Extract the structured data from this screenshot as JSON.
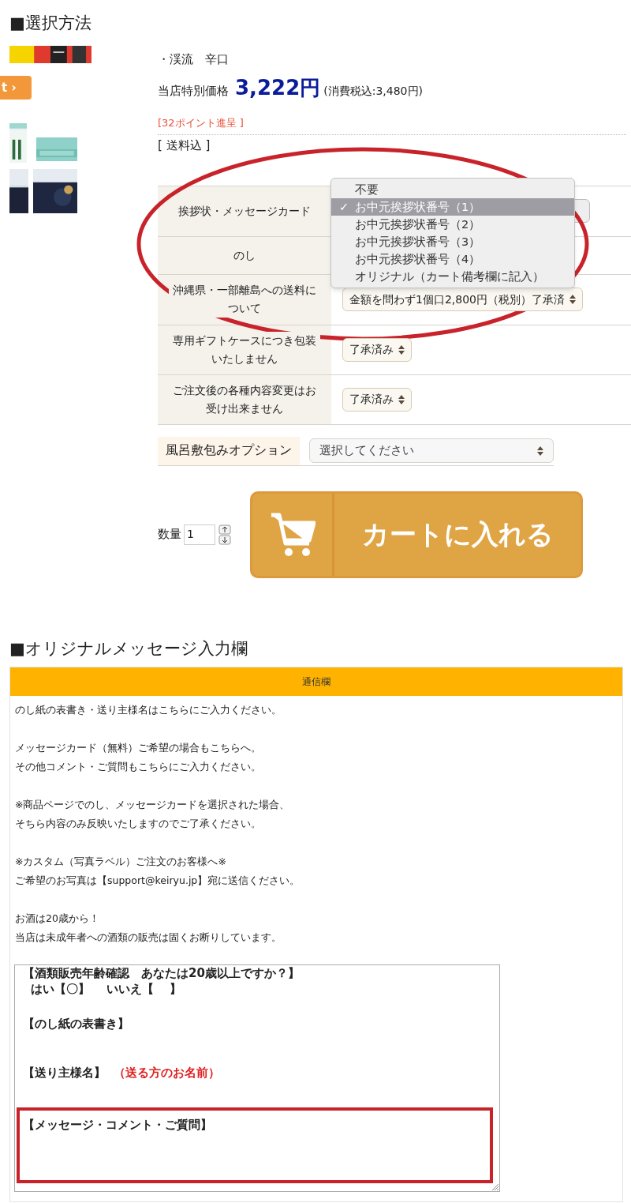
{
  "section_1": {
    "heading": "■選択方法"
  },
  "product": {
    "name": "・渓流　辛口",
    "price_label": "当店特別価格",
    "price": "3,222円",
    "tax_note": "(消費税込:3,480円)",
    "points": "[32ポイント進呈 ]",
    "shipping": "[ 送料込 ]",
    "button_fragment": "t ›"
  },
  "options": [
    {
      "label": "挨拶状・メッセージカード",
      "kind": "covered"
    },
    {
      "label": "のし",
      "kind": "empty"
    },
    {
      "label": "沖縄県・一部離島への送料について",
      "kind": "select",
      "value": "金額を問わず1個口2,800円（税別）了承済"
    },
    {
      "label": "専用ギフトケースにつき包装いたしません",
      "kind": "select",
      "value": "了承済み"
    },
    {
      "label": "ご注文後の各種内容変更はお受け出来ません",
      "kind": "select",
      "value": "了承済み"
    }
  ],
  "dropdown_check": "✓",
  "dropdown": [
    {
      "label": "不要",
      "selected": false
    },
    {
      "label": "お中元挨拶状番号（1）",
      "selected": true
    },
    {
      "label": "お中元挨拶状番号（2）",
      "selected": false
    },
    {
      "label": "お中元挨拶状番号（3）",
      "selected": false
    },
    {
      "label": "お中元挨拶状番号（4）",
      "selected": false
    },
    {
      "label": "オリジナル（カート備考欄に記入）",
      "selected": false
    }
  ],
  "furoshiki": {
    "label": "風呂敷包みオプション",
    "placeholder": "選択してください"
  },
  "quantity": {
    "label": "数量",
    "value": "1"
  },
  "cart_button": {
    "label": "カートに入れる"
  },
  "section_2": {
    "heading": "■オリジナルメッセージ入力欄"
  },
  "message_box": {
    "title": "通信欄",
    "paragraphs": [
      [
        "のし紙の表書き・送り主様名はこちらにご入力ください。"
      ],
      [
        "メッセージカード（無料）ご希望の場合もこちらへ。",
        "その他コメント・ご質問もこちらにご入力ください。"
      ],
      [
        "※商品ページでのし、メッセージカードを選択された場合、",
        "そちら内容のみ反映いたしますのでご了承ください。"
      ],
      [
        "※カスタム（写真ラベル）ご注文のお客様へ※",
        "ご希望のお写真は【support@keiryu.jp】宛に送信ください。"
      ],
      [
        "お酒は20歳から！",
        "当店は未成年者への酒類の販売は固くお断りしています。"
      ]
    ],
    "field_lines": [
      {
        "text": "【酒類販売年齢確認　あなたは20歳以上ですか？】"
      },
      {
        "text": "  はい【〇】　 いいえ【　 】"
      },
      {
        "text": "【のし紙の表書き】"
      },
      {
        "text": "【送り主様名】",
        "note": "（送る方のお名前）"
      },
      {
        "text": "【メッセージ・コメント・ご質問】"
      }
    ]
  }
}
